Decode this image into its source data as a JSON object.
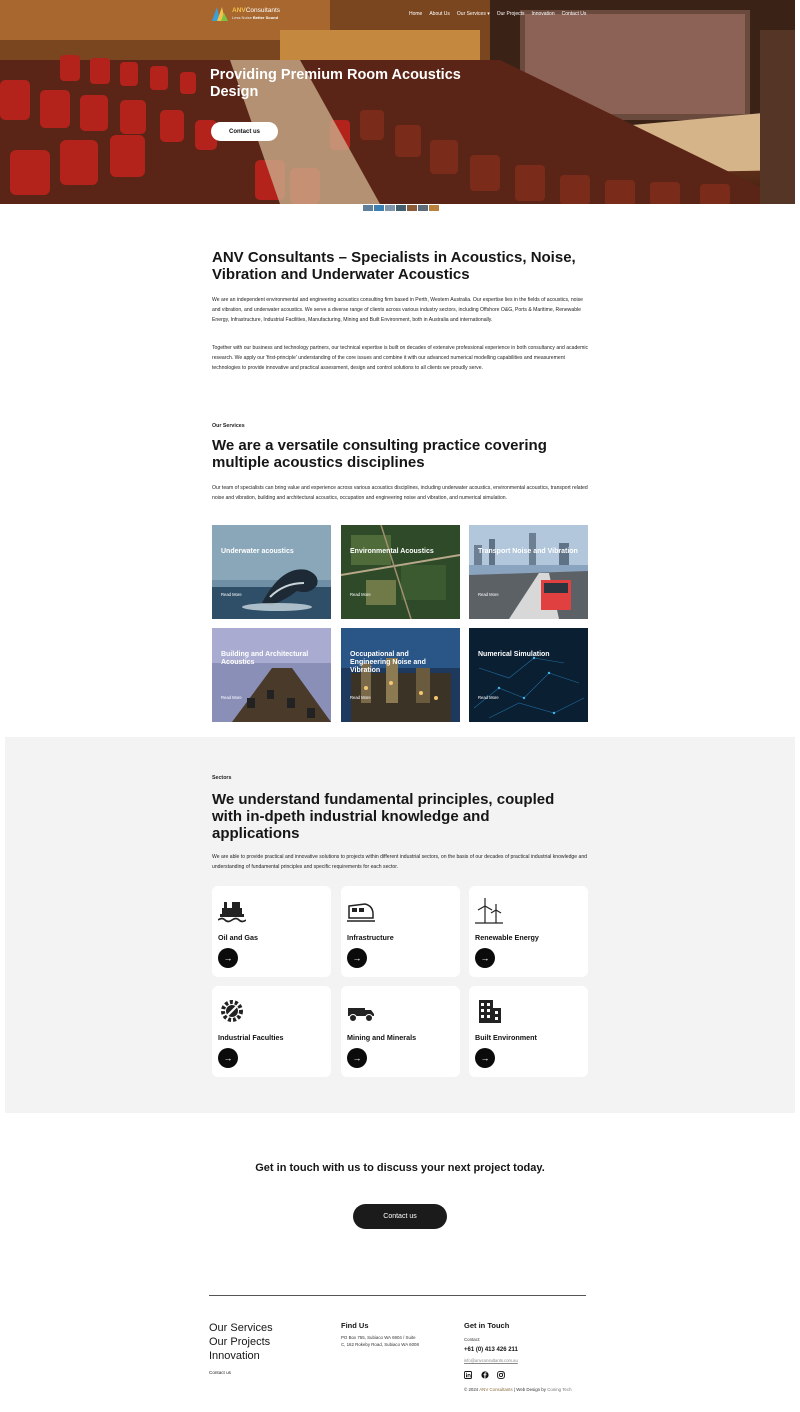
{
  "header": {
    "logo_brand": "ANV",
    "logo_name": "Consultants",
    "logo_tagline_prefix": "Less Noise",
    "logo_tagline_bold": "Better Sound",
    "nav": [
      "Home",
      "About Us",
      "Our Services",
      "Our Projects",
      "Innovation",
      "Contact Us"
    ],
    "nav_dropdown_icon": "chevron-down-icon"
  },
  "hero": {
    "title": "Providing Premium Room Acoustics Design",
    "button": "Contact us",
    "thumbnail_colors": [
      "#5f7f9a",
      "#3d7fb1",
      "#7c95a8",
      "#44606f",
      "#8a5c3a",
      "#5d6b7a",
      "#b8823e"
    ]
  },
  "intro": {
    "title": "ANV Consultants – Specialists in Acoustics, Noise, Vibration and Underwater Acoustics",
    "para1": "We are an independent environmental and engineering acoustics consulting firm based in Perth, Western Australia. Our expertise lies in the fields of acoustics, noise and vibration, and underwater acoustics. We serve a diverse range of clients across various industry sectors, including Offshore O&G, Ports & Maritime, Renewable Energy, Infrastructure, Industrial Facilities, Manufacturing, Mining and Built Environment, both in Australia and internationally.",
    "para2": "Together with our business and technology partners, our technical expertise is built on decades of extensive professional experience in both consultancy and academic research. We apply our 'first-principle' understanding of the core issues and combine it with our advanced numerical modelling capabilities and measurement technologies to provide innovative and practical assessment, design and control solutions to all clients we proudly serve."
  },
  "services": {
    "eyebrow": "Our Services",
    "title": "We are a versatile consulting practice covering multiple acoustics disciplines",
    "description": "Our team of specialists can bring value and experience across various acoustics disciplines, including underwater acoustics, environmental acoustics, transport related noise and vibration, building and architectural acoustics, occupation and engineering noise and vibration, and numerical simulation.",
    "read_more": "Read More",
    "cards": [
      {
        "title": "Underwater acoustics"
      },
      {
        "title": "Environmental Acoustics"
      },
      {
        "title": "Transport Noise and Vibration"
      },
      {
        "title": "Building and Architectural Acoustics"
      },
      {
        "title": "Occupational and Engineering Noise and Vibration"
      },
      {
        "title": "Numerical Simulation"
      }
    ]
  },
  "sectors": {
    "eyebrow": "Sectors",
    "title": "We understand fundamental principles, coupled with in-dpeth industrial knowledge and applications",
    "description": "We are able to provide practical and innovative solutions to projects within different industrial sectors, on the basis of our decades of practical industrial knowledge and understanding of fundamental principles and specific requirements for each sector.",
    "items": [
      {
        "title": "Oil and Gas",
        "icon": "oil-rig-icon"
      },
      {
        "title": "Infrastructure",
        "icon": "train-icon"
      },
      {
        "title": "Renewable Energy",
        "icon": "wind-turbine-icon"
      },
      {
        "title": "Industrial Faculties",
        "icon": "gear-wrench-icon"
      },
      {
        "title": "Mining and Minerals",
        "icon": "mining-truck-icon"
      },
      {
        "title": "Built Environment",
        "icon": "building-icon"
      }
    ],
    "arrow_icon": "arrow-right-icon"
  },
  "cta": {
    "text": "Get in touch with us to discuss your next project today.",
    "button": "Contact us"
  },
  "footer": {
    "links": [
      "Our Services",
      "Our Projects",
      "Innovation"
    ],
    "contact_link": "Contact us",
    "find_us_heading": "Find Us",
    "address": "PO Box 755, Subiaco WA 6904 / Suite C, 162 Rokeby Road, Subiaco WA 6008",
    "get_in_touch_heading": "Get in Touch",
    "contact_label": "Contact:",
    "phone": "+61 (0) 413 426 211",
    "email": "info@anvconsultants.com.au",
    "social": [
      "linkedin-icon",
      "facebook-icon",
      "instagram-icon"
    ],
    "copyright_prefix": "© 2024",
    "copyright_company": "ANV Consultants",
    "copyright_sep": "| Web Design by",
    "copyright_designer": "Coning Tech"
  }
}
